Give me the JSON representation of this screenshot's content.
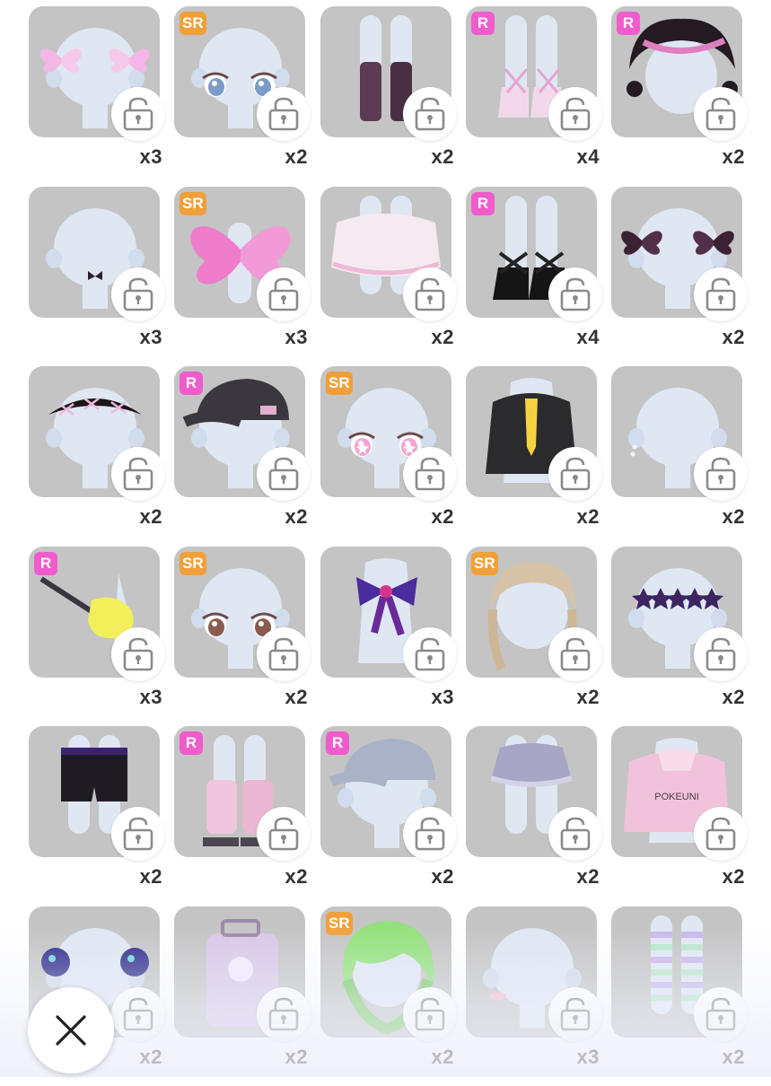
{
  "colors": {
    "card_bg": "#c4c4c4",
    "sr_badge": "#f0a03a",
    "r_badge": "#f05ccc",
    "lock_bg": "#ffffff"
  },
  "close_button": {
    "icon": "close-icon"
  },
  "items": [
    {
      "art": "hair-clip-pink-butterflies",
      "rarity": "",
      "qty": "x3"
    },
    {
      "art": "eyes-blue",
      "rarity": "SR",
      "qty": "x2"
    },
    {
      "art": "stockings-black-purple",
      "rarity": "",
      "qty": "x2"
    },
    {
      "art": "shoes-pink-ballet",
      "rarity": "R",
      "qty": "x4"
    },
    {
      "art": "hair-black-braid-bun",
      "rarity": "R",
      "qty": "x2"
    },
    {
      "art": "choker-black-bow",
      "rarity": "",
      "qty": "x3"
    },
    {
      "art": "wings-pink-butterfly",
      "rarity": "SR",
      "qty": "x3"
    },
    {
      "art": "skirt-white-pink",
      "rarity": "",
      "qty": "x2"
    },
    {
      "art": "shoes-black-mary-jane",
      "rarity": "R",
      "qty": "x4"
    },
    {
      "art": "hair-clip-dark-butterflies",
      "rarity": "",
      "qty": "x2"
    },
    {
      "art": "headband-black-braid",
      "rarity": "",
      "qty": "x2"
    },
    {
      "art": "cap-black",
      "rarity": "R",
      "qty": "x2"
    },
    {
      "art": "eyes-pink-star",
      "rarity": "SR",
      "qty": "x2"
    },
    {
      "art": "jacket-black-yellow-tie",
      "rarity": "",
      "qty": "x2"
    },
    {
      "art": "earring-silver",
      "rarity": "",
      "qty": "x2"
    },
    {
      "art": "guitar-yellow",
      "rarity": "R",
      "qty": "x3"
    },
    {
      "art": "eyes-brown",
      "rarity": "SR",
      "qty": "x2"
    },
    {
      "art": "bow-purple-ribbon",
      "rarity": "",
      "qty": "x3"
    },
    {
      "art": "hair-blonde-braids",
      "rarity": "SR",
      "qty": "x2"
    },
    {
      "art": "headpiece-purple-stars",
      "rarity": "",
      "qty": "x2"
    },
    {
      "art": "shorts-black-purple",
      "rarity": "",
      "qty": "x2"
    },
    {
      "art": "leg-warmers-pink",
      "rarity": "R",
      "qty": "x2"
    },
    {
      "art": "cap-grey-blue",
      "rarity": "R",
      "qty": "x2"
    },
    {
      "art": "skirt-grey-ruffle",
      "rarity": "",
      "qty": "x2"
    },
    {
      "art": "hoodie-pink-pokeuni",
      "rarity": "",
      "qty": "x2"
    },
    {
      "art": "hair-ties-blue-skull",
      "rarity": "",
      "qty": "x2"
    },
    {
      "art": "suitcase-lavender",
      "rarity": "",
      "qty": "x2"
    },
    {
      "art": "hair-green-short",
      "rarity": "SR",
      "qty": "x2"
    },
    {
      "art": "blush-pink",
      "rarity": "",
      "qty": "x3"
    },
    {
      "art": "stockings-pastel-stripes",
      "rarity": "",
      "qty": "x2"
    }
  ],
  "hoodie_print": "POKEUNI"
}
